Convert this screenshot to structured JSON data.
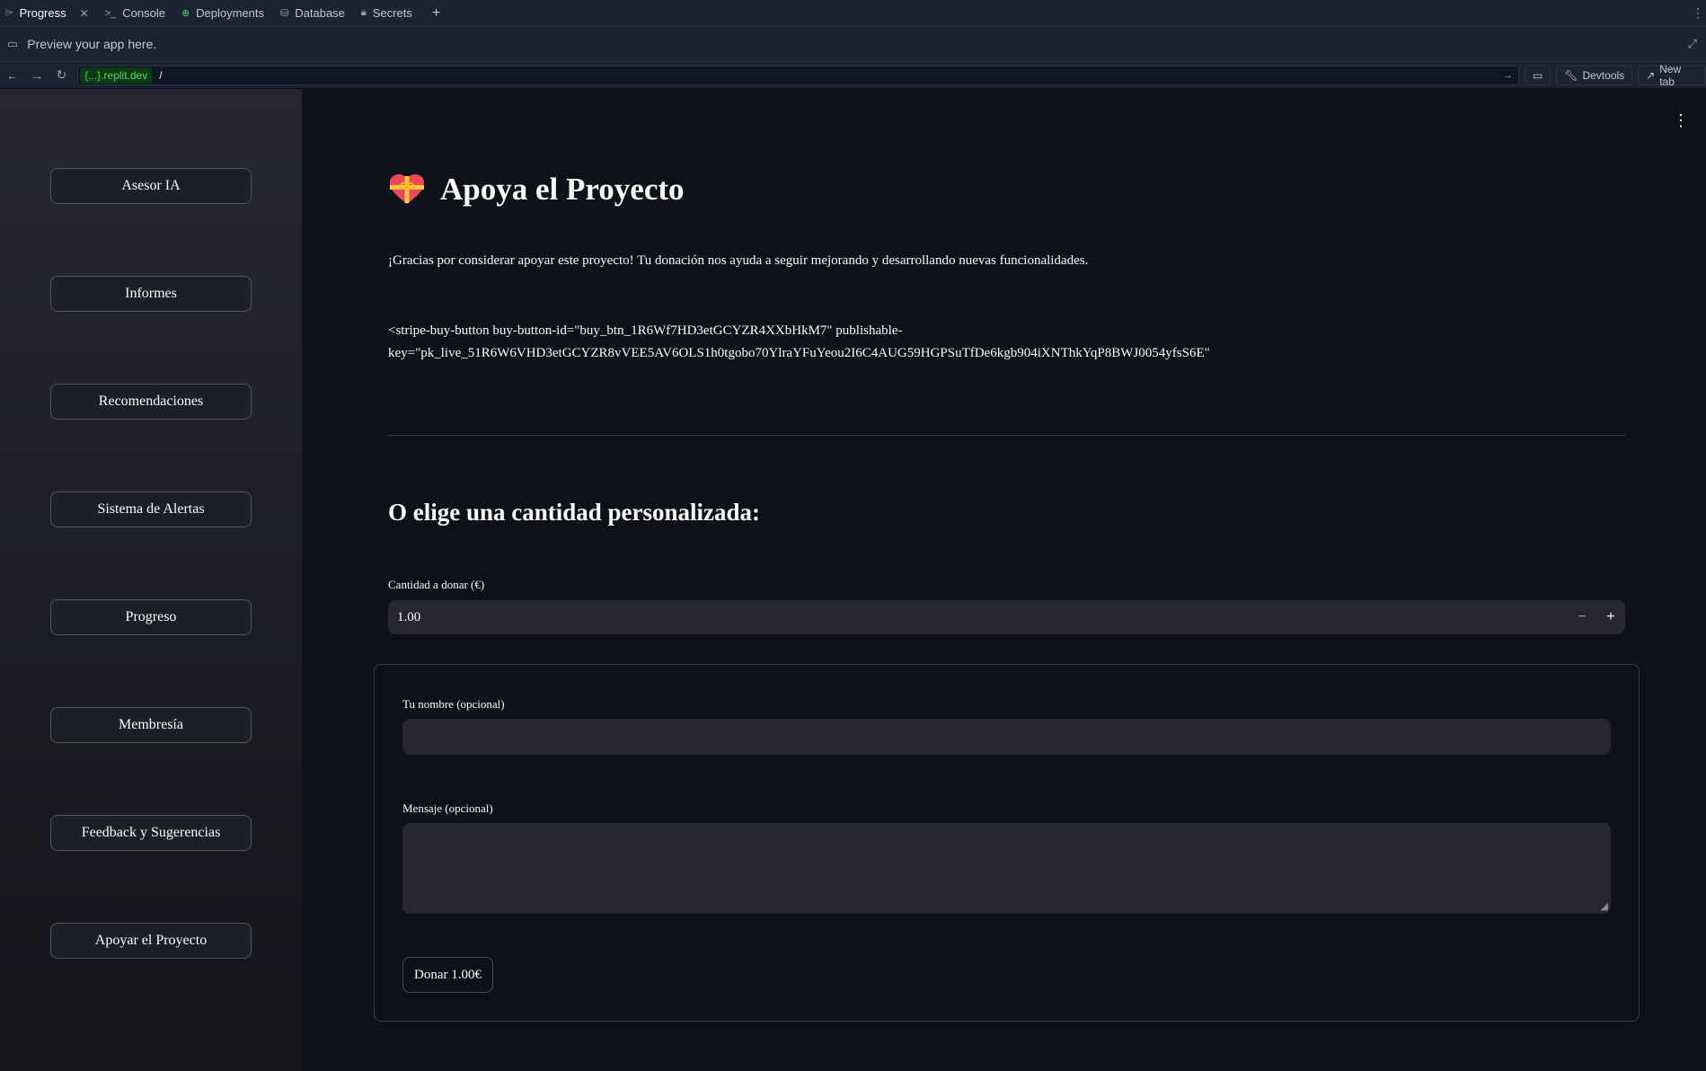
{
  "tabs": [
    {
      "label": "Progress",
      "icon": "progress-icon",
      "active": true
    },
    {
      "label": "Console",
      "icon": "terminal-icon"
    },
    {
      "label": "Deployments",
      "icon": "deployments-icon"
    },
    {
      "label": "Database",
      "icon": "database-icon"
    },
    {
      "label": "Secrets",
      "icon": "lock-icon"
    }
  ],
  "preview": {
    "text": "Preview your app here."
  },
  "urlbar": {
    "domain": "{...}.replit.dev",
    "path": "/",
    "devtools_label": "Devtools",
    "newtab_label": "New tab"
  },
  "sidebar": {
    "items": [
      {
        "label": "Asesor IA"
      },
      {
        "label": "Informes"
      },
      {
        "label": "Recomendaciones"
      },
      {
        "label": "Sistema de Alertas"
      },
      {
        "label": "Progreso"
      },
      {
        "label": "Membresía"
      },
      {
        "label": "Feedback y Sugerencias"
      },
      {
        "label": "Apoyar el Proyecto"
      }
    ]
  },
  "main": {
    "title": "Apoya el Proyecto",
    "intro": "¡Gracias por considerar apoyar este proyecto! Tu donación nos ayuda a seguir mejorando y desarrollando nuevas funcionalidades.",
    "code_line1": "<stripe-buy-button buy-button-id=\"buy_btn_1R6Wf7HD3etGCYZR4XXbHkM7\" publishable-",
    "code_line2": "key=\"pk_live_51R6W6VHD3etGCYZR8vVEE5AV6OLS1h0tgobo70YlraYFuYeou2I6C4AUG59HGPSuTfDe6kgb904iXNThkYqP8BWJ0054yfsS6E\"",
    "subtitle": "O elige una cantidad personalizada:",
    "amount_label": "Cantidad a donar (€)",
    "amount_value": "1.00",
    "name_label": "Tu nombre (opcional)",
    "name_value": "",
    "message_label": "Mensaje (opcional)",
    "message_value": "",
    "donate_label": "Donar 1.00€"
  },
  "colors": {
    "background": "#0e1117",
    "sidebar": "#262730",
    "input": "#262730",
    "text": "#fafafa",
    "replit_domain": "#58d16b"
  }
}
